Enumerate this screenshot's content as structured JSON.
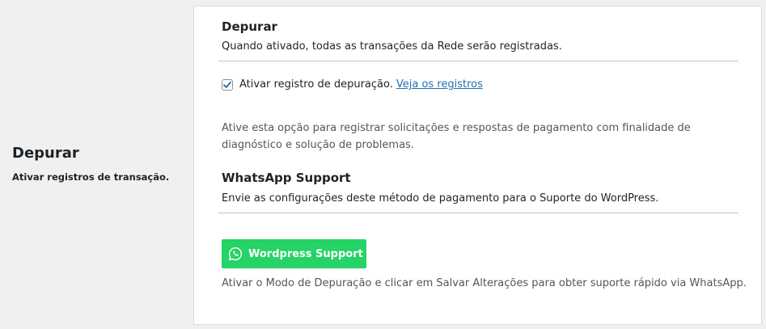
{
  "left": {
    "title": "Depurar",
    "description": "Ativar registros de transação."
  },
  "debug": {
    "title": "Depurar",
    "description": "Quando ativado, todas as transações da Rede serão registradas.",
    "checkbox_label": "Ativar registro de depuração.",
    "checkbox_checked": true,
    "logs_link": "Veja os registros",
    "help_text": "Ative esta opção para registrar solicitações e respostas de pagamento com finalidade de diagnóstico e solução de problemas."
  },
  "whatsapp": {
    "title": "WhatsApp Support",
    "description": "Envie as configurações deste método de pagamento para o Suporte do WordPress.",
    "button_label": "Wordpress Support",
    "button_icon": "whatsapp-icon",
    "button_color": "#25d366",
    "help_text": "Ativar o Modo de Depuração e clicar em Salvar Alterações para obter suporte rápido via WhatsApp."
  },
  "colors": {
    "link": "#2271b1",
    "background": "#f0f0f1",
    "card": "#ffffff"
  }
}
